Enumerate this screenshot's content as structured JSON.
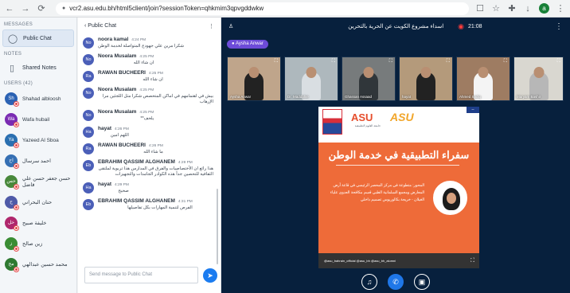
{
  "browser": {
    "url": "vcr2.asu.edu.bh/html5client/join?sessionToken=qhkmim3qpvgddwkw",
    "profile_initial": "a"
  },
  "left_panel": {
    "messages_title": "MESSAGES",
    "public_chat": "Public Chat",
    "notes_title": "NOTES",
    "shared_notes": "Shared Notes",
    "users_title": "USERS (42)",
    "users": [
      {
        "initials": "Sh",
        "name": "Shahad albloosh",
        "color": "#2b62b3"
      },
      {
        "initials": "Wa",
        "name": "Wafa hubail",
        "color": "#7a2bb2"
      },
      {
        "initials": "Ya",
        "name": "Yazeed Al Sboa",
        "color": "#2a6fb0"
      },
      {
        "initials": "اح",
        "name": "احمد سرسال",
        "color": "#356fb3"
      },
      {
        "initials": "حس",
        "name": "حسن جعفر حسن علي فاضل",
        "color": "#48883b"
      },
      {
        "initials": "ح",
        "name": "حنان البحراني",
        "color": "#4f5aa8"
      },
      {
        "initials": "خل",
        "name": "خليفة صبيح",
        "color": "#b0276d"
      },
      {
        "initials": "ز",
        "name": "زين صالح",
        "color": "#3a8d34"
      },
      {
        "initials": "مح",
        "name": "محمد حسين عبدالهي",
        "color": "#2f7a32"
      }
    ]
  },
  "chat": {
    "title": "Public Chat",
    "placeholder": "Send message to Public Chat",
    "messages": [
      {
        "initials": "No",
        "name": "noora kamal",
        "time": "4:24 PM",
        "text": "شكرا مرين علي جهودج المتواصلة لخدمة الوطن"
      },
      {
        "initials": "No",
        "name": "Noora Musalam",
        "time": "4:25 PM",
        "text": "ان شاء الله"
      },
      {
        "initials": "Ra",
        "name": "RAWAN BUCHEERI",
        "time": "4:25 PM",
        "text": "ان شاء الله"
      },
      {
        "initials": "No",
        "name": "Noora Musalam",
        "time": "4:25 PM",
        "text": "بيش في اهتمامهم في اماكن المتحصص شكرا مثل اللجئين مرا الإرهاب"
      },
      {
        "initials": "No",
        "name": "Noora Musalam",
        "time": "4:25 PM",
        "text": "يلحف**"
      },
      {
        "initials": "Ha",
        "name": "hayat",
        "time": "4:26 PM",
        "text": "اللهم امين"
      },
      {
        "initials": "Ra",
        "name": "RAWAN BUCHEERI",
        "time": "4:26 PM",
        "text": "ما شاء الله"
      },
      {
        "initials": "Eb",
        "name": "EBRAHIM QASSIM ALGHANEM",
        "time": "4:29 PM",
        "text": "هذا رائع ان الأختصاصيات والفرق في المدارس هذا تربوية لملتقى الثقافية للتحصين جداً هذه الكوادر الجامدات والتجهيزات"
      },
      {
        "initials": "Ha",
        "name": "hayat",
        "time": "4:29 PM",
        "text": "صحيح"
      },
      {
        "initials": "Eb",
        "name": "EBRAHIM QASSIM ALGHANEM",
        "time": "4:31 PM",
        "text": "الفرص لتنمية المهارات بكل تفاصيلها"
      }
    ]
  },
  "meeting": {
    "title": "اسداء مشروع الكويت عن الحرية بالتحرين",
    "clock": "21:08",
    "presenter": "Aysha Anwar",
    "participants": [
      {
        "name": "Aysha Anwar",
        "bg": "#bfa58b",
        "cloth": "#222222"
      },
      {
        "name": "Dr. Maddahie",
        "bg": "#aeb8bd",
        "cloth": "#d9dee2"
      },
      {
        "name": "Ghassan Assaad",
        "bg": "#777b7c",
        "cloth": "#30363a"
      },
      {
        "name": "hayat",
        "bg": "#b49a7b",
        "cloth": "#222222"
      },
      {
        "name": "Ahmed Sadiq",
        "bg": "#9e7c62",
        "cloth": "#f4f4f4"
      },
      {
        "name": "Maryam Bashir",
        "bg": "#d9d7d0",
        "cloth": "#b7b7b7"
      }
    ],
    "slide": {
      "university": "ASU",
      "university_subtitle": "جامعة العلوم التطبيقية",
      "brand": "ASU",
      "tab": "--",
      "title": "سفراء التطبيقية في خدمة الوطن",
      "body": "المحور: متطوعة في مركز المحصر الرئيسي في قاعة أرض المعارض ومجمع السلمانية الطبي قسم مكافحة العدوى علياء الغيلان - خريجة بكالوريوس تصميم داخلي",
      "footer": "@asu_bahrain_official     @asu_bh     @asu_bh_alumni"
    },
    "controls": [
      "microphone",
      "phone",
      "camera"
    ]
  }
}
